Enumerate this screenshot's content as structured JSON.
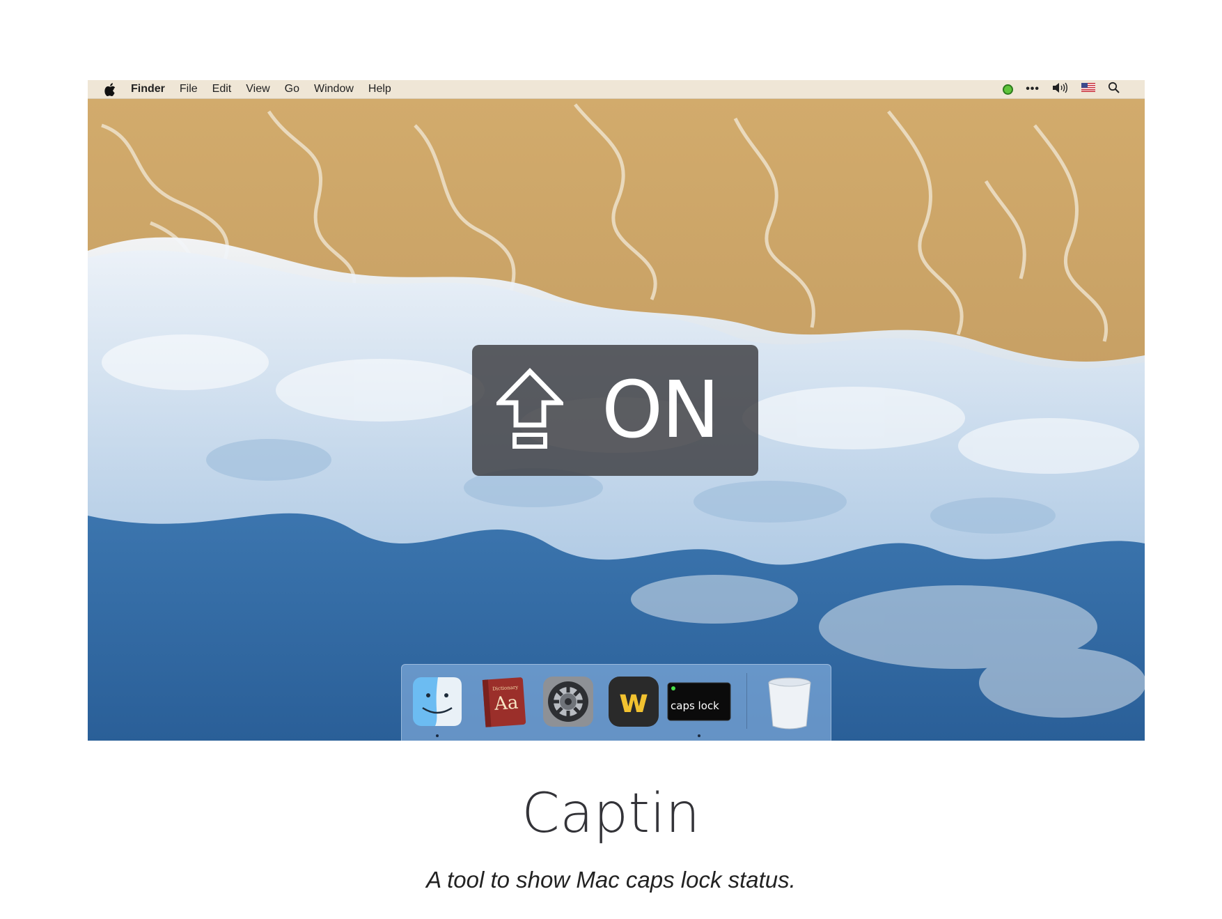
{
  "menubar": {
    "apple_icon": "apple-icon",
    "app_name": "Finder",
    "items": [
      "File",
      "Edit",
      "View",
      "Go",
      "Window",
      "Help"
    ],
    "status_icons": [
      "green-status-dot-icon",
      "ellipsis-icon",
      "volume-icon",
      "us-flag-icon",
      "search-icon"
    ],
    "ellipsis_text": "•••"
  },
  "hud": {
    "icon": "caps-lock-arrow-icon",
    "state": "ON"
  },
  "dock": {
    "items": [
      {
        "name": "Finder",
        "icon": "finder-icon",
        "running": true
      },
      {
        "name": "Dictionary",
        "icon": "dictionary-icon",
        "label": "Aa",
        "sublabel": "Dictionary",
        "running": false
      },
      {
        "name": "System Preferences",
        "icon": "system-preferences-icon",
        "running": false
      },
      {
        "name": "W app",
        "icon": "w-app-icon",
        "label": "w",
        "running": false
      },
      {
        "name": "Captin",
        "icon": "caps-lock-app-icon",
        "label": "caps lock",
        "running": true
      },
      {
        "name": "Trash",
        "icon": "trash-icon",
        "running": false
      }
    ]
  },
  "caption": {
    "title": "Captin",
    "subtitle": "A tool to show Mac caps lock status."
  },
  "colors": {
    "menubar_bg": "#efe6d6",
    "hud_bg": "#3c3c40",
    "sand": "#c9a46a",
    "ocean": "#2f6aa3",
    "foam": "#eef4fb",
    "caption_text": "#333338"
  }
}
